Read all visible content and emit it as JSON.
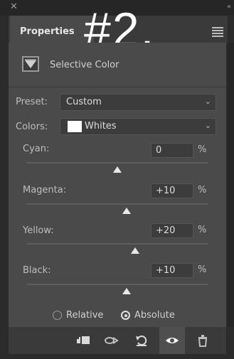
{
  "overlay": {
    "text": "#2."
  },
  "panel": {
    "tab_label": "Properties",
    "adjustment_title": "Selective Color"
  },
  "preset": {
    "label": "Preset:",
    "value": "Custom"
  },
  "colors": {
    "label": "Colors:",
    "value": "Whites",
    "swatch_color": "#ffffff"
  },
  "sliders": [
    {
      "label": "Cyan:",
      "value": "0",
      "unit": "%",
      "position": 0.5
    },
    {
      "label": "Magenta:",
      "value": "+10",
      "unit": "%",
      "position": 0.55
    },
    {
      "label": "Yellow:",
      "value": "+20",
      "unit": "%",
      "position": 0.6
    },
    {
      "label": "Black:",
      "value": "+10",
      "unit": "%",
      "position": 0.55
    }
  ],
  "method": {
    "options": [
      "Relative",
      "Absolute"
    ],
    "selected": "Absolute"
  },
  "bottom_bar": {
    "icons": [
      "clip-to-layer-icon",
      "view-previous-state-icon",
      "reset-icon",
      "visibility-eye-icon",
      "trash-icon"
    ]
  }
}
